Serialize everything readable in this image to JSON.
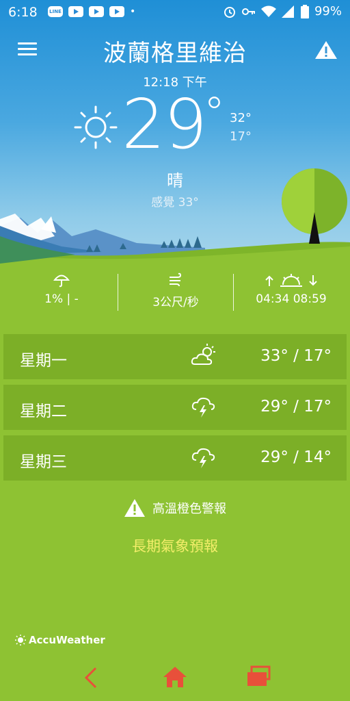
{
  "status": {
    "time": "6:18",
    "line_label": "LINE",
    "battery": "99%"
  },
  "header": {
    "city": "波蘭格里維治",
    "updated": "12:18 下午"
  },
  "current": {
    "temp": "29",
    "deg": "°",
    "high": "32°",
    "low": "17°",
    "condition": "晴",
    "feels_like": "感覺 33°"
  },
  "stats": {
    "precip": "1% | -",
    "wind": "3公尺/秒",
    "sun_times": "04:34  08:59"
  },
  "forecast": [
    {
      "day": "星期一",
      "temps": "33° / 17°",
      "icon": "partly-cloudy-icon"
    },
    {
      "day": "星期二",
      "temps": "29° / 17°",
      "icon": "thunderstorm-icon"
    },
    {
      "day": "星期三",
      "temps": "29° / 14°",
      "icon": "thunderstorm-icon"
    }
  ],
  "alert": {
    "text": "高溫橙色警報"
  },
  "long_range_label": "長期氣象預報",
  "brand": "AccuWeather",
  "colors": {
    "sky_top": "#1f8fd6",
    "grass": "#8ec233",
    "long_range_link": "#f4ee6a",
    "nav_icons": "#e8503a"
  }
}
